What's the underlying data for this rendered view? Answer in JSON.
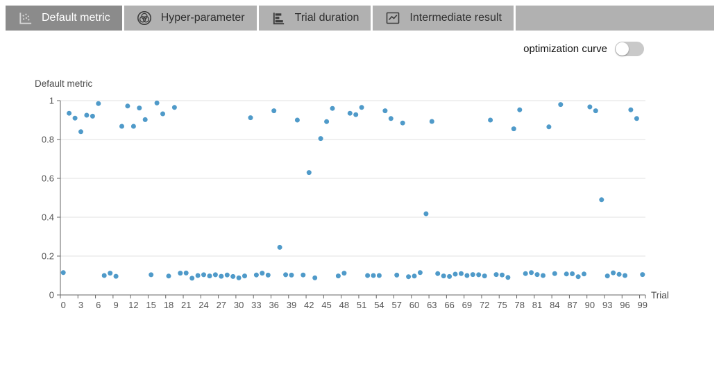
{
  "tabs": [
    {
      "label": "Default metric",
      "icon": "scatter-chart-icon",
      "active": true
    },
    {
      "label": "Hyper-parameter",
      "icon": "venn-icon",
      "active": false
    },
    {
      "label": "Trial duration",
      "icon": "horizontal-bar-chart-icon",
      "active": false
    },
    {
      "label": "Intermediate result",
      "icon": "line-chart-icon",
      "active": false
    }
  ],
  "controls": {
    "optimization_curve": {
      "label": "optimization curve",
      "state": "off"
    }
  },
  "colors": {
    "dot": "#4f9ac9",
    "axis": "#666666",
    "grid": "#e2e2e2",
    "tick_text": "#555555",
    "title_text": "#4a4a4a",
    "tab_active_bg": "#8b8b8b",
    "tab_bg": "#b1b1b1",
    "toggle_track": "#c9c9c9"
  },
  "chart_data": {
    "type": "scatter",
    "title": "Default metric",
    "xlabel": "Trial",
    "ylabel": "Default metric",
    "x_range": [
      0,
      99
    ],
    "x_tick_step": 3,
    "ylim": [
      0,
      1
    ],
    "y_ticks": [
      0,
      0.2,
      0.4,
      0.6,
      0.8,
      1
    ],
    "grid": "horizontal",
    "legend": "none",
    "series": [
      {
        "name": "Default metric",
        "x": [
          0,
          1,
          2,
          3,
          4,
          5,
          6,
          7,
          8,
          9,
          10,
          11,
          12,
          13,
          14,
          15,
          16,
          17,
          18,
          19,
          20,
          21,
          22,
          23,
          24,
          25,
          26,
          27,
          28,
          29,
          30,
          31,
          32,
          33,
          34,
          35,
          36,
          37,
          38,
          39,
          40,
          41,
          42,
          43,
          44,
          45,
          46,
          47,
          48,
          49,
          50,
          51,
          52,
          53,
          54,
          55,
          56,
          57,
          58,
          59,
          60,
          61,
          62,
          63,
          64,
          65,
          66,
          67,
          68,
          69,
          70,
          71,
          72,
          73,
          74,
          75,
          76,
          77,
          78,
          79,
          80,
          81,
          82,
          83,
          84,
          85,
          86,
          87,
          88,
          89,
          90,
          91,
          92,
          93,
          94,
          95,
          96,
          97,
          98,
          99
        ],
        "y": [
          0.115,
          0.935,
          0.91,
          0.84,
          0.925,
          0.92,
          0.985,
          0.1,
          0.112,
          0.096,
          0.868,
          0.972,
          0.868,
          0.962,
          0.902,
          0.104,
          0.988,
          0.932,
          0.097,
          0.965,
          0.112,
          0.113,
          0.086,
          0.1,
          0.104,
          0.098,
          0.104,
          0.096,
          0.103,
          0.095,
          0.088,
          0.098,
          0.912,
          0.103,
          0.112,
          0.102,
          0.948,
          0.245,
          0.104,
          0.102,
          0.9,
          0.103,
          0.63,
          0.088,
          0.805,
          0.892,
          0.96,
          0.098,
          0.112,
          0.935,
          0.928,
          0.965,
          0.1,
          0.1,
          0.1,
          0.948,
          0.908,
          0.102,
          0.885,
          0.094,
          0.097,
          0.115,
          0.418,
          0.893,
          0.11,
          0.098,
          0.095,
          0.107,
          0.11,
          0.1,
          0.105,
          0.104,
          0.098,
          0.9,
          0.105,
          0.103,
          0.09,
          0.855,
          0.953,
          0.11,
          0.115,
          0.105,
          0.1,
          0.865,
          0.11,
          0.98,
          0.108,
          0.109,
          0.094,
          0.108,
          0.968,
          0.948,
          0.49,
          0.098,
          0.114,
          0.106,
          0.1,
          0.953,
          0.908,
          0.105
        ]
      }
    ]
  }
}
